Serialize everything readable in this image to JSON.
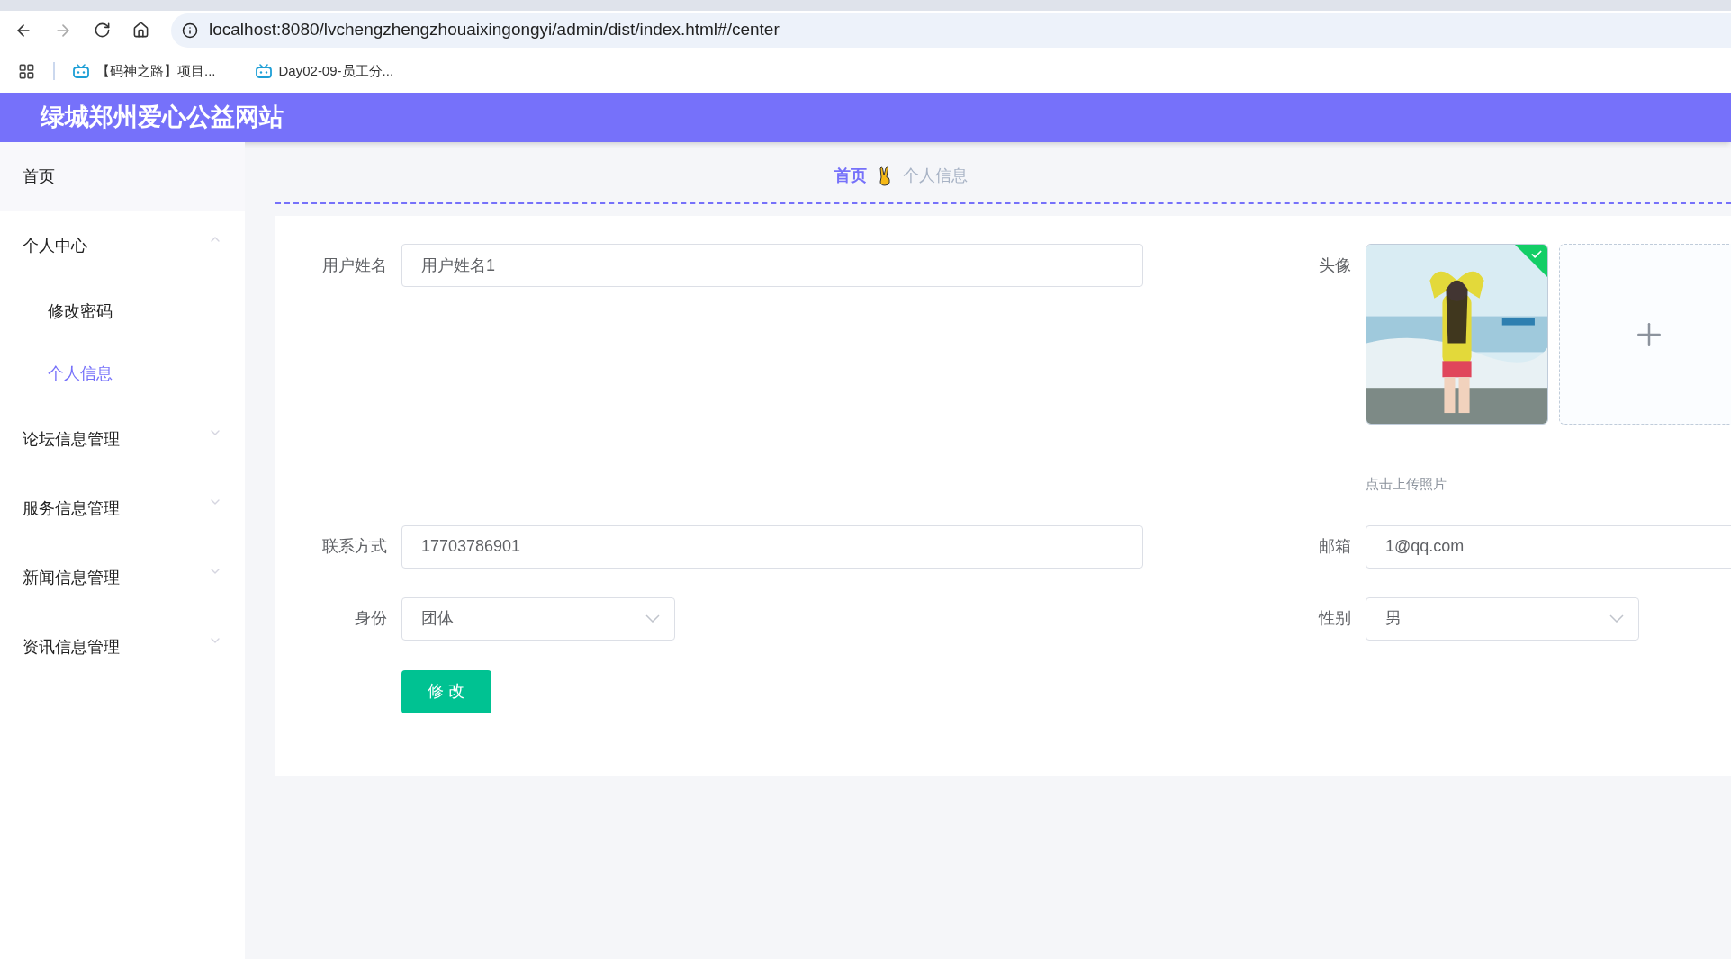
{
  "browser": {
    "url": "localhost:8080/lvchengzhengzhouaixingongyi/admin/dist/index.html#/center",
    "bookmarks": [
      {
        "label": "【码神之路】项目..."
      },
      {
        "label": "Day02-09-员工分..."
      }
    ]
  },
  "header": {
    "title": "绿城郑州爱心公益网站"
  },
  "sidebar": {
    "items": [
      {
        "kind": "link",
        "label": "首页",
        "selected": false
      },
      {
        "kind": "group",
        "label": "个人中心",
        "expanded": true,
        "children": [
          {
            "label": "修改密码",
            "selected": false
          },
          {
            "label": "个人信息",
            "selected": true
          }
        ]
      },
      {
        "kind": "group",
        "label": "论坛信息管理",
        "expanded": false
      },
      {
        "kind": "group",
        "label": "服务信息管理",
        "expanded": false
      },
      {
        "kind": "group",
        "label": "新闻信息管理",
        "expanded": false
      },
      {
        "kind": "group",
        "label": "资讯信息管理",
        "expanded": false
      }
    ]
  },
  "breadcrumb": [
    {
      "label": "首页",
      "selected": true
    },
    {
      "label": "个人信息",
      "selected": false
    }
  ],
  "form": {
    "username": {
      "label": "用户姓名",
      "value": "用户姓名1"
    },
    "avatar": {
      "label": "头像",
      "hint": "点击上传照片"
    },
    "contact": {
      "label": "联系方式",
      "value": "17703786901"
    },
    "email": {
      "label": "邮箱",
      "value": "1@qq.com"
    },
    "identity": {
      "label": "身份",
      "value": "团体"
    },
    "gender": {
      "label": "性别",
      "value": "男"
    },
    "submit": "修 改"
  }
}
